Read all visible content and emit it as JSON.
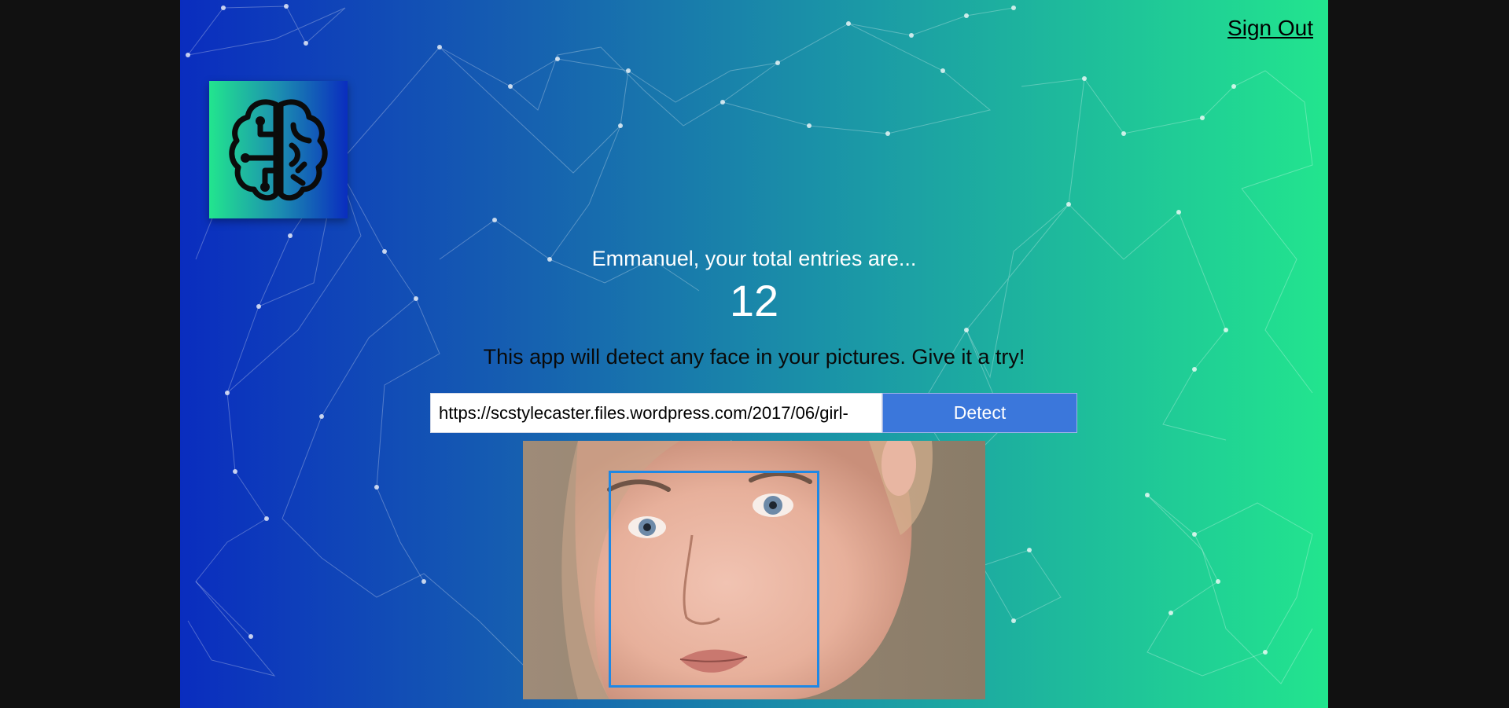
{
  "header": {
    "sign_out_label": "Sign Out"
  },
  "logo": {
    "icon": "brain-icon"
  },
  "rank": {
    "message": "Emmanuel, your total entries are...",
    "count": "12"
  },
  "description": "This app will detect any face in your pictures. Give it a try!",
  "image_form": {
    "url_value": "https://scstylecaster.files.wordpress.com/2017/06/girl-",
    "detect_label": "Detect"
  },
  "result_image": {
    "content": "close-up portrait of a woman's face",
    "face_boxes_detected": 1
  },
  "colors": {
    "gradient_start": "#0a2dbf",
    "gradient_end": "#22e58e",
    "button": "#3b77db",
    "face_box": "#1e88e5"
  }
}
